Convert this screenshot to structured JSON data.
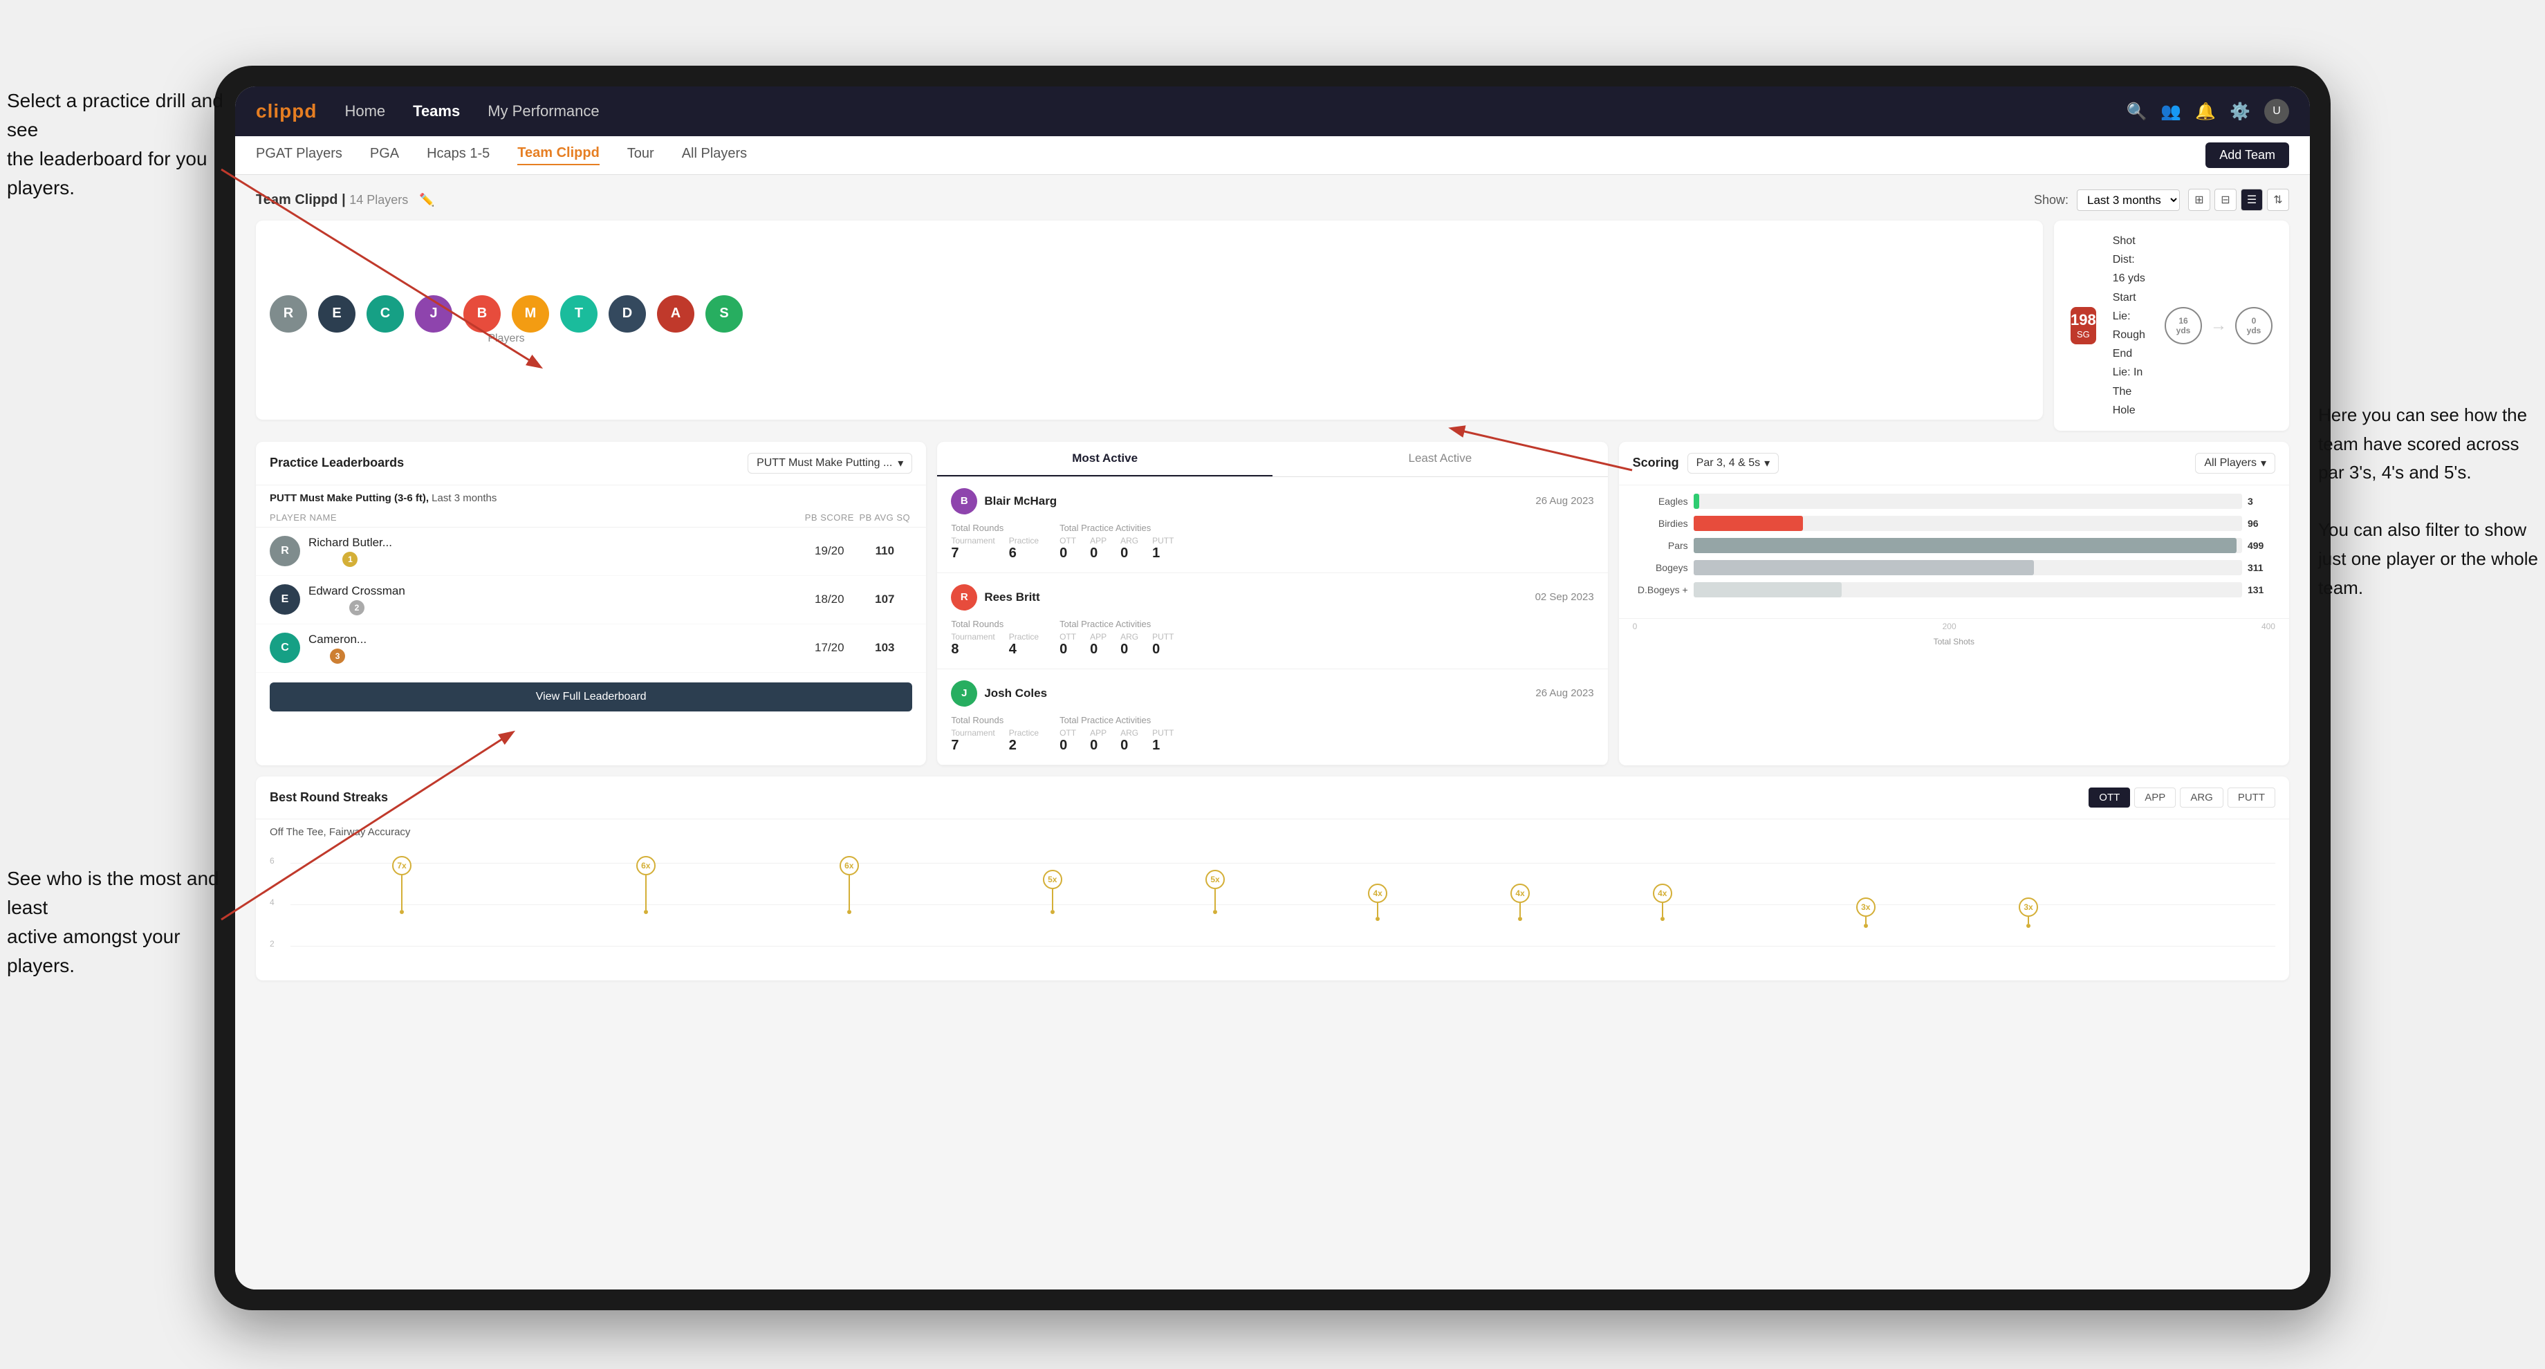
{
  "page": {
    "brand": "clippd",
    "navbar": {
      "links": [
        "Home",
        "Teams",
        "My Performance"
      ],
      "icons": [
        "search",
        "user-group",
        "bell",
        "settings",
        "avatar"
      ],
      "active_link": "Teams"
    },
    "sub_navbar": {
      "links": [
        "PGAT Players",
        "PGA",
        "Hcaps 1-5",
        "Team Clippd",
        "Tour",
        "All Players"
      ],
      "active": "Team Clippd",
      "add_team_label": "Add Team"
    },
    "team_header": {
      "title": "Team Clippd",
      "player_count": "14 Players",
      "show_label": "Show:",
      "show_value": "Last 3 months",
      "view_options": [
        "grid-2",
        "grid-4",
        "list",
        "sort"
      ]
    },
    "players_strip": {
      "label": "Players",
      "avatar_count": 10
    },
    "shot_info": {
      "badge_number": "198",
      "badge_sub": "SG",
      "details_line1": "Shot Dist: 16 yds",
      "details_line2": "Start Lie: Rough",
      "details_line3": "End Lie: In The Hole",
      "circle1_val": "16",
      "circle1_label": "yds",
      "circle2_val": "0",
      "circle2_label": "yds"
    },
    "practice_leaderboards": {
      "card_title": "Practice Leaderboards",
      "filter_label": "PUTT Must Make Putting ...",
      "subtitle_drill": "PUTT Must Make Putting (3-6 ft),",
      "subtitle_period": "Last 3 months",
      "table_headers": [
        "PLAYER NAME",
        "PB SCORE",
        "PB AVG SQ"
      ],
      "players": [
        {
          "name": "Richard Butler...",
          "score": "19/20",
          "avg": "110",
          "rank": 1,
          "badge_color": "gold"
        },
        {
          "name": "Edward Crossman",
          "score": "18/20",
          "avg": "107",
          "rank": 2,
          "badge_color": "silver"
        },
        {
          "name": "Cameron...",
          "score": "17/20",
          "avg": "103",
          "rank": 3,
          "badge_color": "bronze"
        }
      ],
      "view_full_label": "View Full Leaderboard"
    },
    "activity": {
      "tabs": [
        "Most Active",
        "Least Active"
      ],
      "active_tab": "Most Active",
      "players": [
        {
          "name": "Blair McHarg",
          "date": "26 Aug 2023",
          "total_rounds_label": "Total Rounds",
          "tournament_label": "Tournament",
          "practice_label": "Practice",
          "tournament_val": "7",
          "practice_val": "6",
          "total_practice_label": "Total Practice Activities",
          "ott_label": "OTT",
          "app_label": "APP",
          "arg_label": "ARG",
          "putt_label": "PUTT",
          "ott_val": "0",
          "app_val": "0",
          "arg_val": "0",
          "putt_val": "1"
        },
        {
          "name": "Rees Britt",
          "date": "02 Sep 2023",
          "tournament_val": "8",
          "practice_val": "4",
          "ott_val": "0",
          "app_val": "0",
          "arg_val": "0",
          "putt_val": "0"
        },
        {
          "name": "Josh Coles",
          "date": "26 Aug 2023",
          "tournament_val": "7",
          "practice_val": "2",
          "ott_val": "0",
          "app_val": "0",
          "arg_val": "0",
          "putt_val": "1"
        }
      ]
    },
    "scoring": {
      "title": "Scoring",
      "filter_label": "Par 3, 4 & 5s",
      "player_filter_label": "All Players",
      "bars": [
        {
          "label": "Eagles",
          "value": 3,
          "max": 500,
          "color": "#2ecc71"
        },
        {
          "label": "Birdies",
          "value": 96,
          "max": 500,
          "color": "#e74c3c"
        },
        {
          "label": "Pars",
          "value": 499,
          "max": 500,
          "color": "#95a5a6"
        },
        {
          "label": "Bogeys",
          "value": 311,
          "max": 500,
          "color": "#bdc3c7"
        },
        {
          "label": "D.Bogeys +",
          "value": 131,
          "max": 500,
          "color": "#d5dbdb"
        }
      ],
      "axis_labels": [
        "0",
        "200",
        "400"
      ],
      "axis_title": "Total Shots"
    },
    "best_round_streaks": {
      "title": "Best Round Streaks",
      "subtitle": "Off The Tee, Fairway Accuracy",
      "filter_buttons": [
        "OTT",
        "APP",
        "ARG",
        "PUTT"
      ],
      "active_filter": "OTT",
      "pins": [
        {
          "label": "7x",
          "position_pct": 10
        },
        {
          "label": "6x",
          "position_pct": 22
        },
        {
          "label": "6x",
          "position_pct": 32
        },
        {
          "label": "5x",
          "position_pct": 42
        },
        {
          "label": "5x",
          "position_pct": 50
        },
        {
          "label": "4x",
          "position_pct": 58
        },
        {
          "label": "4x",
          "position_pct": 65
        },
        {
          "label": "4x",
          "position_pct": 72
        },
        {
          "label": "3x",
          "position_pct": 82
        },
        {
          "label": "3x",
          "position_pct": 90
        }
      ]
    },
    "annotations": {
      "top_left": "Select a practice drill and see\nthe leaderboard for you players.",
      "bottom_left": "See who is the most and least\nactive amongst your players.",
      "right": "Here you can see how the\nteam have scored across\npar 3's, 4's and 5's.\n\nYou can also filter to show\njust one player or the whole\nteam."
    }
  }
}
